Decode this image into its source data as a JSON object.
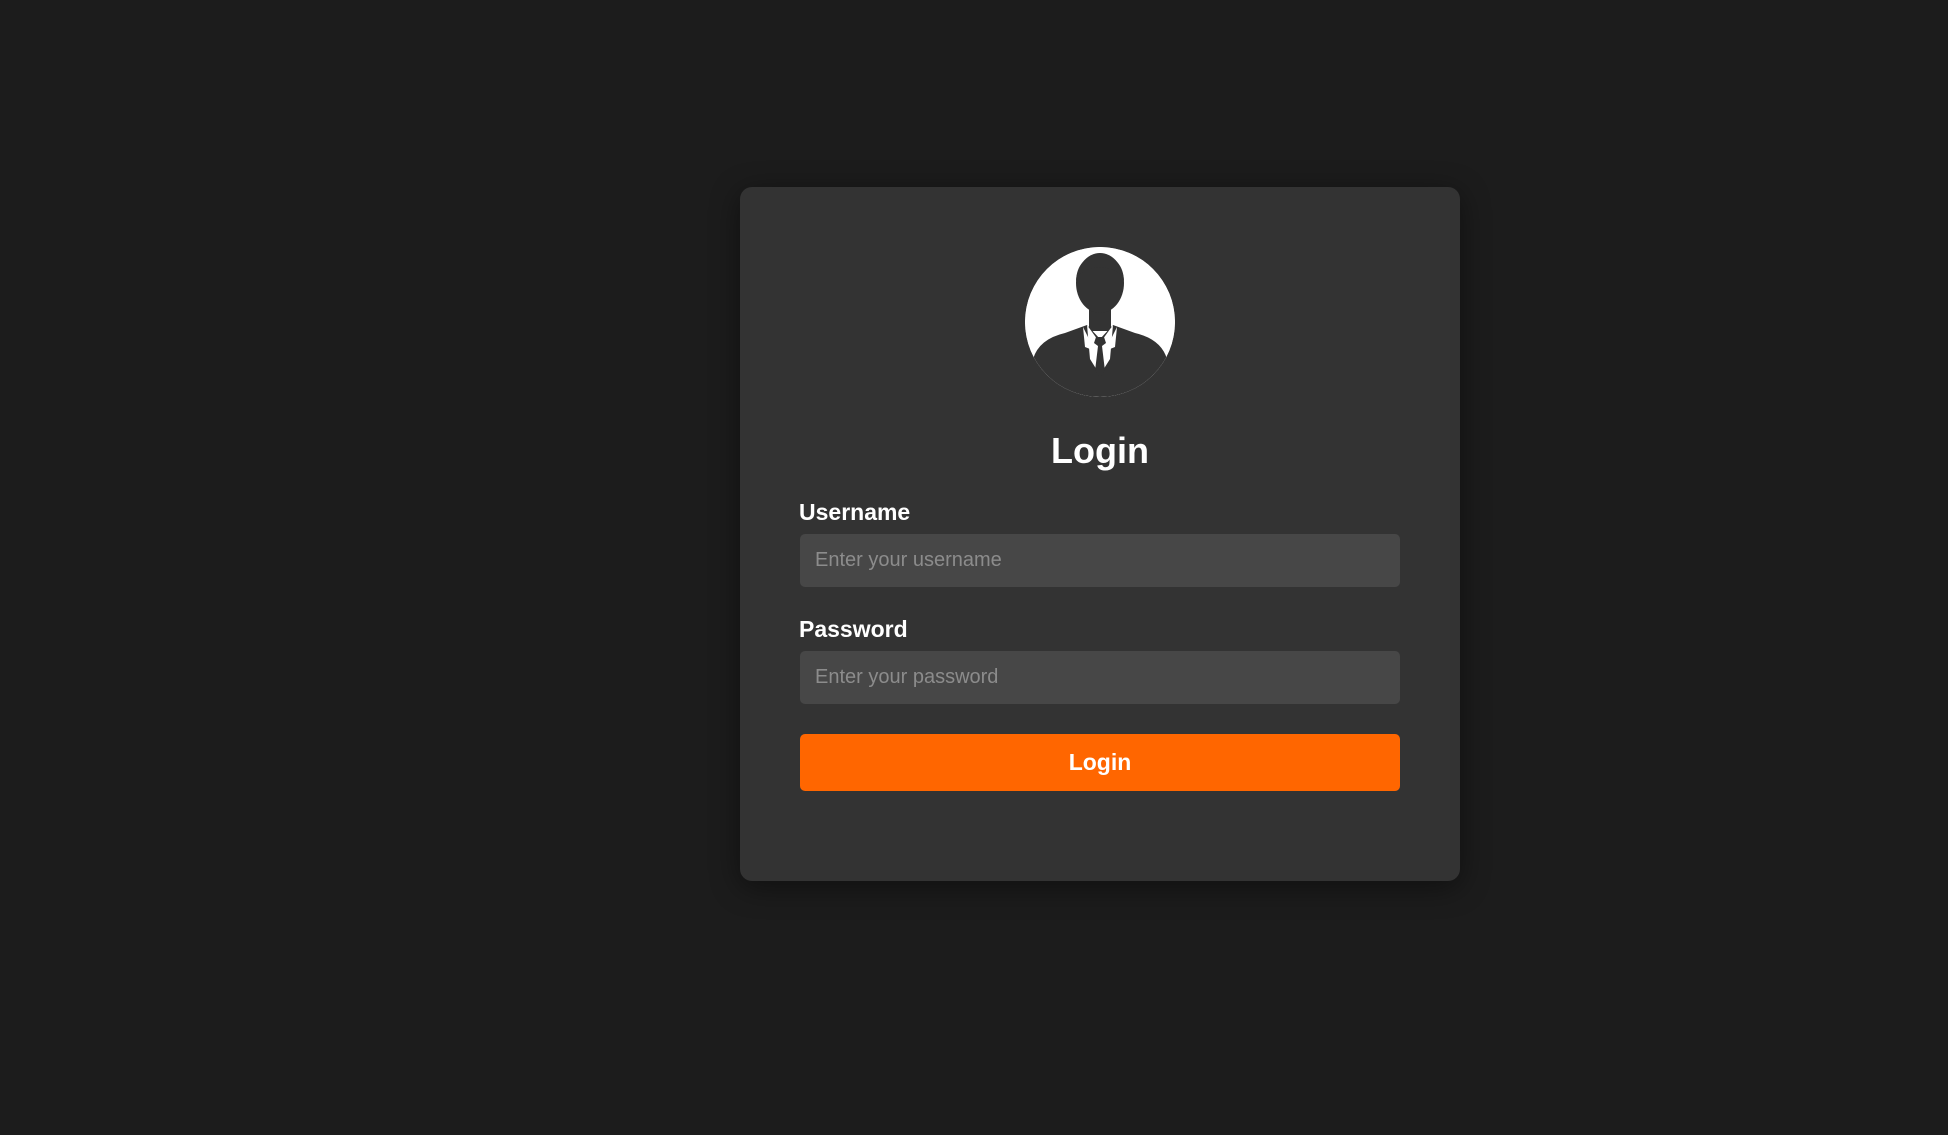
{
  "login": {
    "title": "Login",
    "avatar_icon": "user-silhouette-icon",
    "username": {
      "label": "Username",
      "placeholder": "Enter your username",
      "value": ""
    },
    "password": {
      "label": "Password",
      "placeholder": "Enter your password",
      "value": ""
    },
    "submit_label": "Login"
  },
  "colors": {
    "page_background": "#1c1c1c",
    "card_background": "#333333",
    "input_background": "#474747",
    "accent": "#ff6600",
    "text": "#ffffff"
  }
}
